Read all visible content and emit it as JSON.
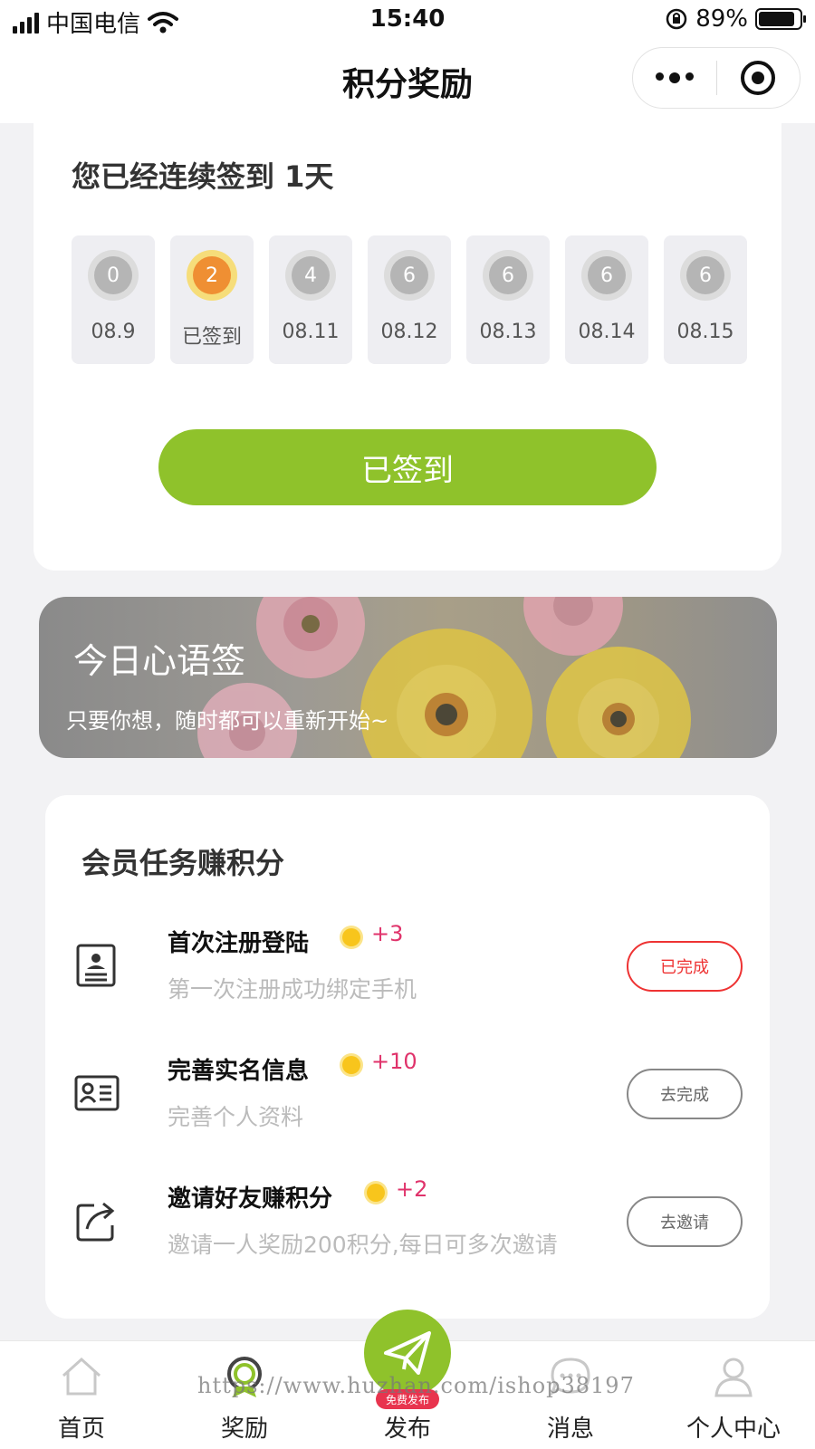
{
  "status_bar": {
    "carrier": "中国电信",
    "time": "15:40",
    "battery_percent": "89%",
    "battery_level": 0.89
  },
  "nav": {
    "title": "积分奖励"
  },
  "sign_in": {
    "title": "您已经连续签到 1天",
    "days": [
      {
        "points": "0",
        "label": "08.9",
        "state": "pending"
      },
      {
        "points": "2",
        "label": "已签到",
        "state": "signed"
      },
      {
        "points": "4",
        "label": "08.11",
        "state": "pending"
      },
      {
        "points": "6",
        "label": "08.12",
        "state": "pending"
      },
      {
        "points": "6",
        "label": "08.13",
        "state": "pending"
      },
      {
        "points": "6",
        "label": "08.14",
        "state": "pending"
      },
      {
        "points": "6",
        "label": "08.15",
        "state": "pending"
      }
    ],
    "button_label": "已签到",
    "button_color": "#8fc22b"
  },
  "quote": {
    "title": "今日心语签",
    "text": "只要你想，随时都可以重新开始~"
  },
  "tasks": {
    "heading": "会员任务赚积分",
    "items": [
      {
        "icon": "profile-document-icon",
        "title": "首次注册登陆",
        "points": "+3",
        "desc": "第一次注册成功绑定手机",
        "button": "已完成",
        "done": true
      },
      {
        "icon": "id-card-icon",
        "title": "完善实名信息",
        "points": "+10",
        "desc": "完善个人资料",
        "button": "去完成",
        "done": false
      },
      {
        "icon": "share-icon",
        "title": "邀请好友赚积分",
        "points": "+2",
        "desc": "邀请一人奖励200积分,每日可多次邀请",
        "button": "去邀请",
        "done": false
      }
    ],
    "points_color": "#e0336b",
    "done_color": "#e33333"
  },
  "tab_bar": {
    "items": [
      {
        "label": "首页",
        "icon": "home-icon"
      },
      {
        "label": "奖励",
        "icon": "reward-icon"
      },
      {
        "label": "发布",
        "icon": "send-icon"
      },
      {
        "label": "消息",
        "icon": "message-icon"
      },
      {
        "label": "个人中心",
        "icon": "user-icon"
      }
    ],
    "publish_badge": "免费发布"
  },
  "watermark": "https://www.huzhan.com/ishop38197"
}
